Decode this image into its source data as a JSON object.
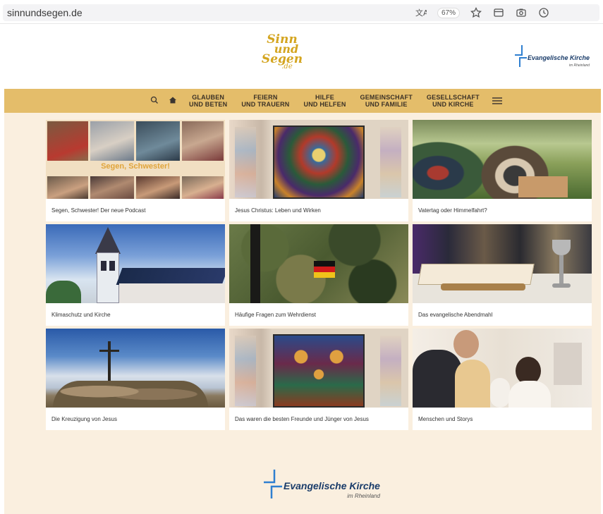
{
  "browser": {
    "url": "sinnundsegen.de",
    "zoom": "67%",
    "icons": [
      "translate-icon",
      "star-icon",
      "reader-icon",
      "screenshot-icon",
      "history-icon"
    ]
  },
  "header": {
    "logo_lines": [
      "Sinn",
      "und",
      "Segen",
      ".de"
    ],
    "partner_logo": {
      "title": "Evangelische Kirche",
      "subtitle": "im Rheinland"
    }
  },
  "nav": {
    "items": [
      {
        "line1": "GLAUBEN",
        "line2": "UND BETEN"
      },
      {
        "line1": "FEIERN",
        "line2": "UND TRAUERN"
      },
      {
        "line1": "HILFE",
        "line2": "UND HELFEN"
      },
      {
        "line1": "GEMEINSCHAFT",
        "line2": "UND FAMILIE"
      },
      {
        "line1": "GESELLSCHAFT",
        "line2": "UND KIRCHE"
      }
    ]
  },
  "tiles": [
    {
      "caption": "Segen, Schwester! Der neue Podcast",
      "overlay": "Segen, Schwester!"
    },
    {
      "caption": "Jesus Christus: Leben und Wirken"
    },
    {
      "caption": "Vatertag oder Himmelfahrt?"
    },
    {
      "caption": "Klimaschutz und Kirche"
    },
    {
      "caption": "Häufige Fragen zum Wehrdienst"
    },
    {
      "caption": "Das evangelische Abendmahl"
    },
    {
      "caption": "Die Kreuzigung von Jesus"
    },
    {
      "caption": "Das waren die besten Freunde und Jünger von Jesus"
    },
    {
      "caption": "Menschen und Storys"
    }
  ],
  "footer": {
    "title": "Evangelische Kirche",
    "subtitle": "im Rheinland"
  },
  "colors": {
    "nav_bg": "#e4bd6a",
    "page_bg": "#faefdf",
    "logo_gold": "#d4a520",
    "ekir_blue": "#1a3c6a"
  }
}
